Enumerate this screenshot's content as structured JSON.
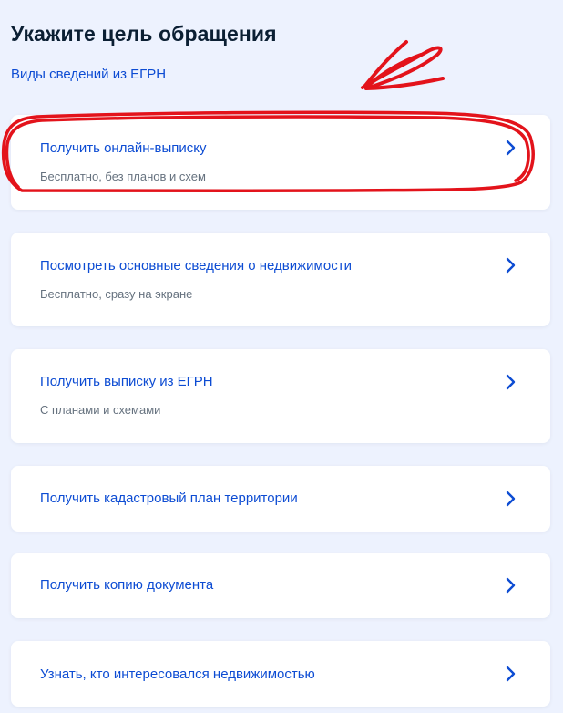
{
  "header": {
    "title": "Укажите цель обращения",
    "link": "Виды сведений из ЕГРН"
  },
  "options": [
    {
      "title": "Получить онлайн-выписку",
      "subtitle": "Бесплатно, без планов и схем"
    },
    {
      "title": "Посмотреть основные сведения о недвижимости",
      "subtitle": "Бесплатно, сразу на экране"
    },
    {
      "title": "Получить выписку из ЕГРН",
      "subtitle": "С планами и схемами"
    },
    {
      "title": "Получить кадастровый план территории"
    },
    {
      "title": "Получить копию документа"
    },
    {
      "title": "Узнать, кто интересовался недвижимостью"
    }
  ],
  "icons": {
    "chevron": "chevron-right-icon"
  },
  "colors": {
    "background": "#edf2fe",
    "card": "#ffffff",
    "title_text": "#0b1f33",
    "link": "#0d4cd3",
    "secondary_text": "#66727f",
    "annotation": "#e3131b"
  }
}
